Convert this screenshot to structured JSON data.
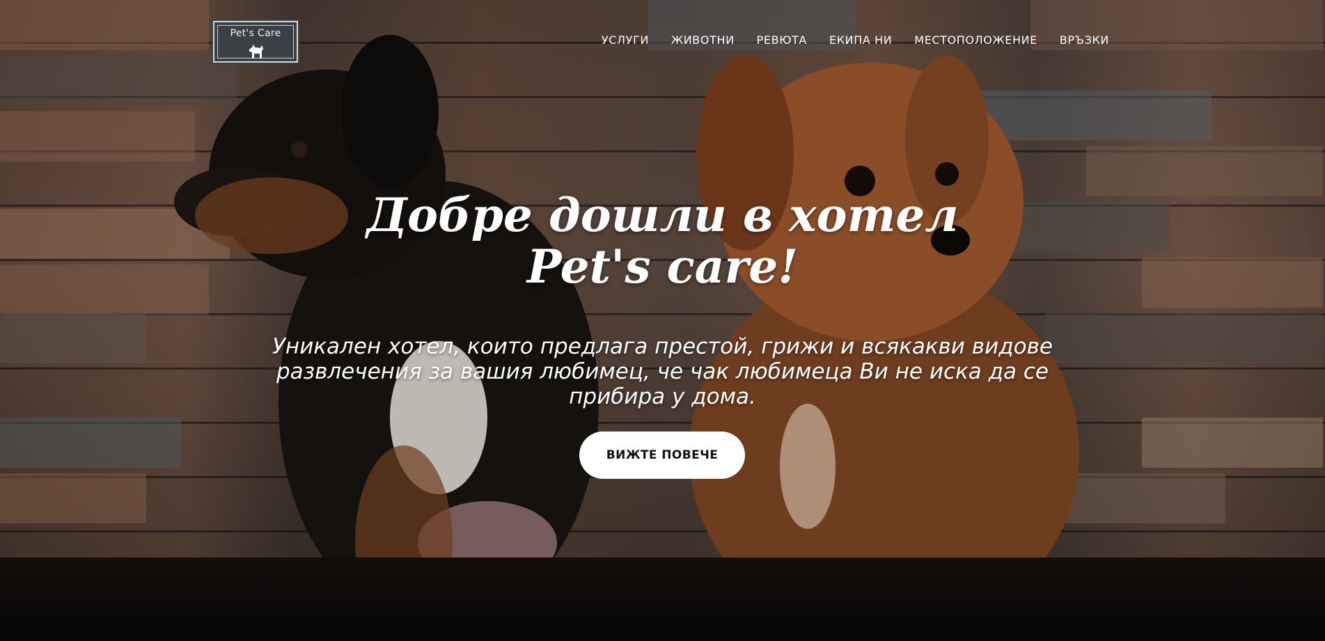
{
  "logo": {
    "text": "Pet's Care",
    "icon": "dog-icon"
  },
  "nav": {
    "items": [
      {
        "label": "УСЛУГИ"
      },
      {
        "label": "ЖИВОТНИ"
      },
      {
        "label": "РЕВЮТА"
      },
      {
        "label": "ЕКИПА НИ"
      },
      {
        "label": "МЕСТОПОЛОЖЕНИЕ"
      },
      {
        "label": "ВРЪЗКИ"
      }
    ]
  },
  "hero": {
    "title_line1": "Добре дошли в хотел",
    "title_line2": "Pet's care!",
    "subtitle_line1": "Уникален хотел, които предлага престой, грижи и всякакви видове",
    "subtitle_line2": "развлечения за вашия любимец, че чак любимеца Ви не иска да се",
    "subtitle_line3": "прибира у дома.",
    "cta_label": "ВИЖТЕ ПОВЕЧЕ",
    "background_image": "two-puppies-brick-wall"
  },
  "colors": {
    "text": "#ffffff",
    "button_bg": "#ffffff",
    "button_text": "#111111",
    "logo_bg": "#3b4046"
  }
}
